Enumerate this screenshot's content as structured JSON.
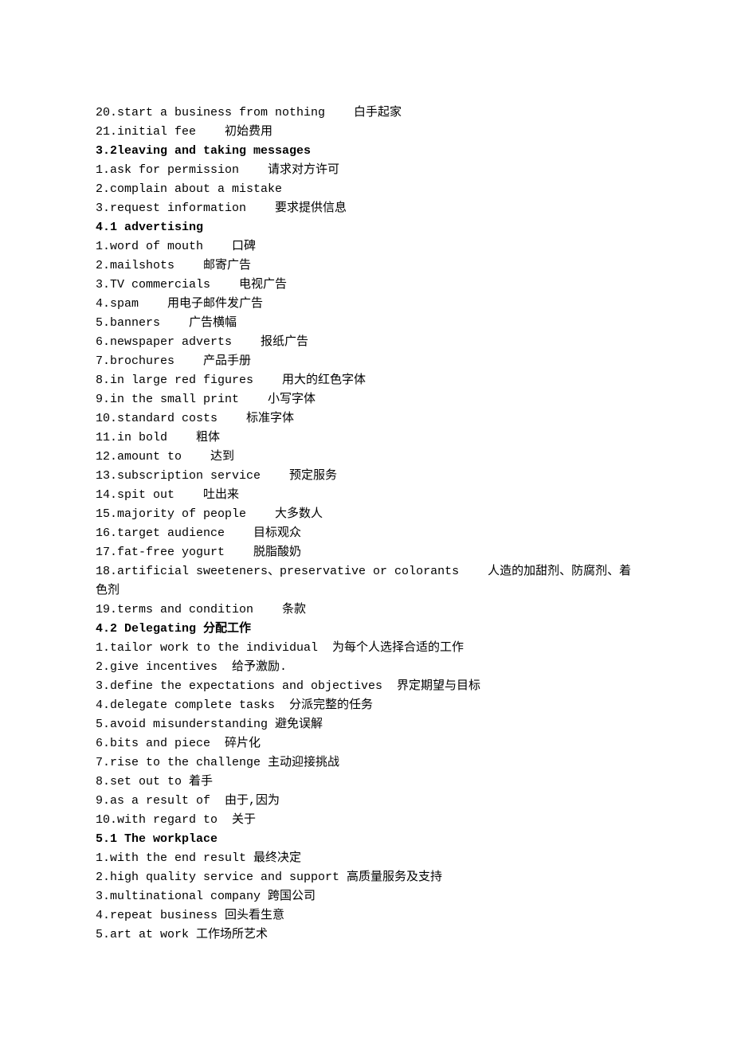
{
  "lines": [
    {
      "type": "item",
      "num": "20.",
      "en": "start a business from nothing",
      "zh": "白手起家"
    },
    {
      "type": "item",
      "num": "21.",
      "en": "initial fee",
      "zh": "初始费用"
    },
    {
      "type": "heading",
      "text": "3.2leaving and taking messages"
    },
    {
      "type": "item",
      "num": "1.",
      "en": "ask for permission",
      "zh": "请求对方许可"
    },
    {
      "type": "item",
      "num": "2.",
      "en": "complain about a mistake",
      "zh": ""
    },
    {
      "type": "item",
      "num": "3.",
      "en": "request information",
      "zh": "要求提供信息"
    },
    {
      "type": "heading",
      "text": "4.1 advertising"
    },
    {
      "type": "item",
      "num": "1.",
      "en": "word of mouth",
      "zh": "口碑"
    },
    {
      "type": "item",
      "num": "2.",
      "en": "mailshots",
      "zh": "邮寄广告"
    },
    {
      "type": "item",
      "num": "3.",
      "en": "TV commercials",
      "zh": "电视广告"
    },
    {
      "type": "item",
      "num": "4.",
      "en": "spam",
      "zh": "用电子邮件发广告"
    },
    {
      "type": "item",
      "num": "5.",
      "en": "banners",
      "zh": "广告横幅"
    },
    {
      "type": "item",
      "num": "6.",
      "en": "newspaper adverts",
      "zh": "报纸广告"
    },
    {
      "type": "item",
      "num": "7.",
      "en": "brochures",
      "zh": "产品手册"
    },
    {
      "type": "item",
      "num": "8.",
      "en": "in large red figures",
      "zh": "用大的红色字体"
    },
    {
      "type": "item",
      "num": "9.",
      "en": "in the small print",
      "zh": "小写字体"
    },
    {
      "type": "item",
      "num": "10.",
      "en": "standard costs",
      "zh": "标准字体"
    },
    {
      "type": "item",
      "num": "11.",
      "en": "in bold",
      "zh": "粗体"
    },
    {
      "type": "item",
      "num": "12.",
      "en": "amount to",
      "zh": "达到"
    },
    {
      "type": "item",
      "num": "13.",
      "en": "subscription service",
      "zh": "预定服务"
    },
    {
      "type": "item",
      "num": "14.",
      "en": "spit out",
      "zh": "吐出来"
    },
    {
      "type": "item",
      "num": "15.",
      "en": "majority of people",
      "zh": "大多数人"
    },
    {
      "type": "item",
      "num": "16.",
      "en": "target audience",
      "zh": "目标观众"
    },
    {
      "type": "item",
      "num": "17.",
      "en": "fat-free yogurt",
      "zh": "脱脂酸奶"
    },
    {
      "type": "item",
      "num": "18.",
      "en": "artificial sweeteners、preservative or colorants",
      "zh": "人造的加甜剂、防腐剂、着色剂",
      "wrap": true
    },
    {
      "type": "item",
      "num": "19.",
      "en": "terms and condition",
      "zh": "条款"
    },
    {
      "type": "heading",
      "text": "4.2 Delegating 分配工作"
    },
    {
      "type": "item",
      "num": "1.",
      "en": "tailor work to the individual",
      "zh": "为每个人选择合适的工作",
      "tight": true
    },
    {
      "type": "item",
      "num": "2.",
      "en": "give incentives",
      "zh": "给予激励.",
      "tight": true
    },
    {
      "type": "item",
      "num": "3.",
      "en": "define the expectations and objectives",
      "zh": "界定期望与目标",
      "tight": true
    },
    {
      "type": "item",
      "num": "4.",
      "en": "delegate complete tasks",
      "zh": "分派完整的任务",
      "tight": true
    },
    {
      "type": "item",
      "num": "5.",
      "en": "avoid misunderstanding",
      "zh": "避免误解",
      "tight2": true
    },
    {
      "type": "item",
      "num": "6.",
      "en": "bits and piece",
      "zh": "碎片化",
      "tight": true
    },
    {
      "type": "item",
      "num": "7.",
      "en": "rise to the challenge",
      "zh": "主动迎接挑战",
      "tight2": true
    },
    {
      "type": "item",
      "num": "8.",
      "en": "set out to",
      "zh": "着手",
      "tight2": true
    },
    {
      "type": "item",
      "num": "9.",
      "en": "as a result of",
      "zh": "由于,因为",
      "tight": true
    },
    {
      "type": "item",
      "num": "10.",
      "en": "with regard to",
      "zh": "关于",
      "tight": true
    },
    {
      "type": "heading",
      "text": "5.1 The workplace"
    },
    {
      "type": "item",
      "num": "1.",
      "en": "with the end result",
      "zh": "最终决定",
      "tight2": true
    },
    {
      "type": "item",
      "num": "2.",
      "en": "high quality service and support",
      "zh": "高质量服务及支持",
      "tight2": true
    },
    {
      "type": "item",
      "num": "3.",
      "en": "multinational company",
      "zh": "跨国公司",
      "tight2": true
    },
    {
      "type": "item",
      "num": "4.",
      "en": "repeat business",
      "zh": "回头看生意",
      "tight2": true
    },
    {
      "type": "item",
      "num": "5.",
      "en": "art at work",
      "zh": "工作场所艺术",
      "tight2": true
    }
  ]
}
